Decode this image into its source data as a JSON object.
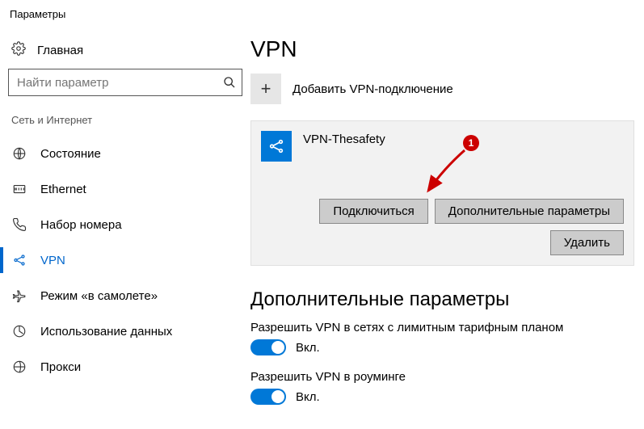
{
  "app_title": "Параметры",
  "home_label": "Главная",
  "search_placeholder": "Найти параметр",
  "nav_group": "Сеть и Интернет",
  "nav": [
    {
      "label": "Состояние"
    },
    {
      "label": "Ethernet"
    },
    {
      "label": "Набор номера"
    },
    {
      "label": "VPN"
    },
    {
      "label": "Режим «в самолете»"
    },
    {
      "label": "Использование данных"
    },
    {
      "label": "Прокси"
    }
  ],
  "page_title": "VPN",
  "add_label": "Добавить VPN-подключение",
  "connection": {
    "name": "VPN-Thesafety",
    "connect_btn": "Подключиться",
    "advanced_btn": "Дополнительные параметры",
    "delete_btn": "Удалить"
  },
  "extra_section_title": "Дополнительные параметры",
  "settings": [
    {
      "label": "Разрешить VPN в сетях с лимитным тарифным планом",
      "state": "Вкл."
    },
    {
      "label": "Разрешить VPN в роуминге",
      "state": "Вкл."
    }
  ],
  "annotation_badge": "1"
}
